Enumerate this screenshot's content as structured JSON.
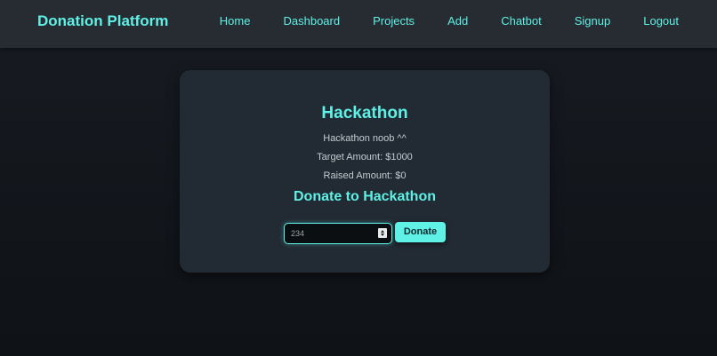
{
  "nav": {
    "brand": "Donation Platform",
    "links": [
      "Home",
      "Dashboard",
      "Projects",
      "Add",
      "Chatbot",
      "Signup",
      "Logout"
    ]
  },
  "project": {
    "title": "Hackathon",
    "description": "Hackathon noob ^^",
    "target": "Target Amount: $1000",
    "raised": "Raised Amount: $0"
  },
  "donate": {
    "heading": "Donate to Hackathon",
    "amount_value": "234",
    "button_label": "Donate"
  },
  "colors": {
    "accent": "#5ff0e6",
    "navbar_bg": "#272c32",
    "card_bg": "#222a33",
    "page_bg": "#12161b"
  }
}
